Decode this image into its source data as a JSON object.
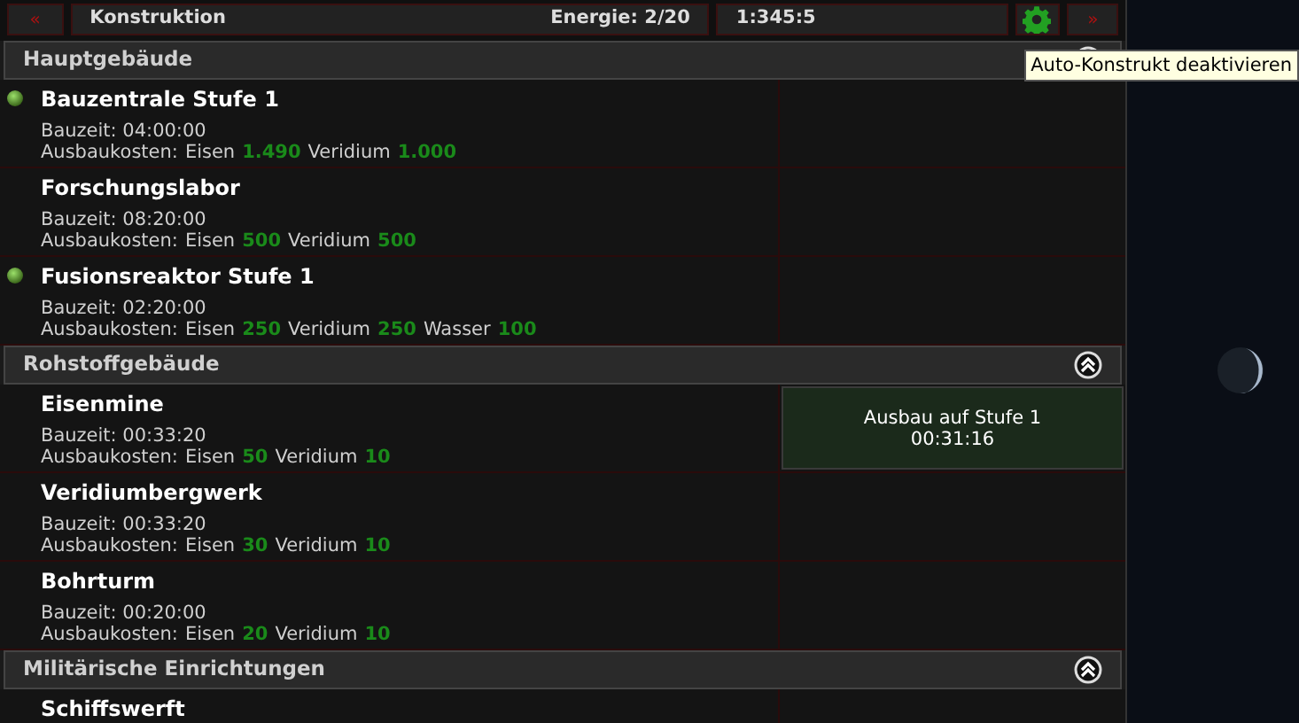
{
  "topbar": {
    "prev": "«",
    "title": "Konstruktion",
    "energy": "Energie: 2/20",
    "coords": "1:345:5",
    "next": "»",
    "tooltip": "Auto-Konstrukt deaktivieren"
  },
  "sections": [
    {
      "title": "Hauptgebäude",
      "expanded": true,
      "rows": [
        {
          "name": "Bauzentrale Stufe 1",
          "indicator": true,
          "build_time": "Bauzeit: 04:00:00",
          "costs_label": "Ausbaukosten:",
          "costs": [
            {
              "resource": "Eisen",
              "amount": "1.490"
            },
            {
              "resource": "Veridium",
              "amount": "1.000"
            }
          ]
        },
        {
          "name": "Forschungslabor",
          "indicator": false,
          "build_time": "Bauzeit: 08:20:00",
          "costs_label": "Ausbaukosten:",
          "costs": [
            {
              "resource": "Eisen",
              "amount": "500"
            },
            {
              "resource": "Veridium",
              "amount": "500"
            }
          ]
        },
        {
          "name": "Fusionsreaktor Stufe 1",
          "indicator": true,
          "build_time": "Bauzeit: 02:20:00",
          "costs_label": "Ausbaukosten:",
          "costs": [
            {
              "resource": "Eisen",
              "amount": "250"
            },
            {
              "resource": "Veridium",
              "amount": "250"
            },
            {
              "resource": "Wasser",
              "amount": "100"
            }
          ]
        }
      ]
    },
    {
      "title": "Rohstoffgebäude",
      "expanded": true,
      "rows": [
        {
          "name": "Eisenmine",
          "indicator": false,
          "build_time": "Bauzeit: 00:33:20",
          "costs_label": "Ausbaukosten:",
          "costs": [
            {
              "resource": "Eisen",
              "amount": "50"
            },
            {
              "resource": "Veridium",
              "amount": "10"
            }
          ],
          "status": [
            "Ausbau auf Stufe 1",
            "00:31:16"
          ]
        },
        {
          "name": "Veridiumbergwerk",
          "indicator": false,
          "build_time": "Bauzeit: 00:33:20",
          "costs_label": "Ausbaukosten:",
          "costs": [
            {
              "resource": "Eisen",
              "amount": "30"
            },
            {
              "resource": "Veridium",
              "amount": "10"
            }
          ]
        },
        {
          "name": "Bohrturm",
          "indicator": false,
          "build_time": "Bauzeit: 00:20:00",
          "costs_label": "Ausbaukosten:",
          "costs": [
            {
              "resource": "Eisen",
              "amount": "20"
            },
            {
              "resource": "Veridium",
              "amount": "10"
            }
          ]
        }
      ]
    },
    {
      "title": "Militärische Einrichtungen",
      "expanded": true,
      "rows": [
        {
          "name": "Schiffswerft",
          "indicator": false
        }
      ]
    }
  ]
}
